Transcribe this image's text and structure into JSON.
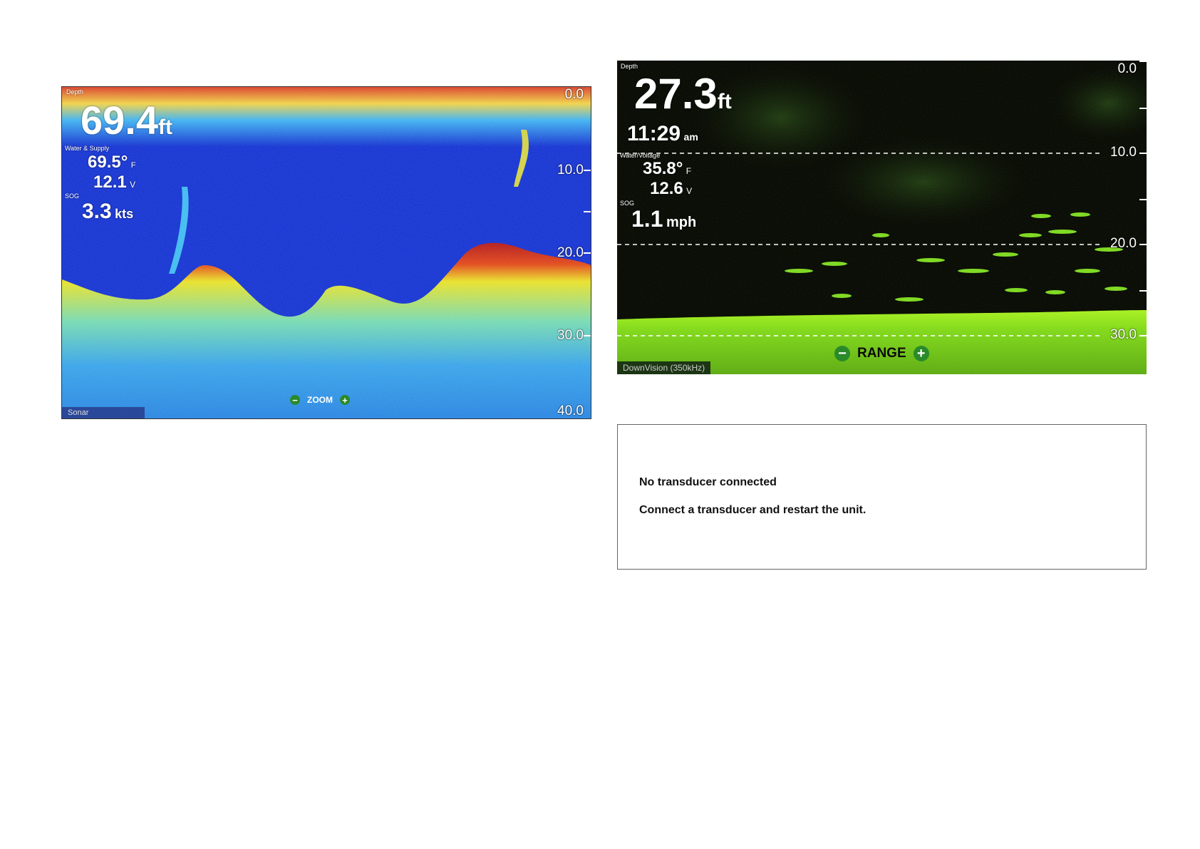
{
  "sonar": {
    "depth_label": "Depth",
    "depth_value": "69.4",
    "depth_unit": "ft",
    "group_label": "Water & Supply",
    "temp_value": "69.5°",
    "temp_unit": "F",
    "volt_value": "12.1",
    "volt_unit": "V",
    "sog_label": "SOG",
    "sog_value": "3.3",
    "sog_unit": "kts",
    "scale": [
      "0.0",
      "10.0",
      "20.0",
      "30.0",
      "40.0"
    ],
    "zoom_label": "ZOOM",
    "minus_glyph": "−",
    "plus_glyph": "+",
    "source_label": "Sonar"
  },
  "downvision": {
    "depth_label": "Depth",
    "depth_value": "27.3",
    "depth_unit": "ft",
    "time_value": "11:29",
    "time_suffix": "am",
    "group_label": "Water/Voltage",
    "temp_value": "35.8°",
    "temp_unit": "F",
    "volt_value": "12.6",
    "volt_unit": "V",
    "sog_label": "SOG",
    "sog_value": "1.1",
    "sog_unit": "mph",
    "scale": [
      "0.0",
      "10.0",
      "20.0",
      "30.0"
    ],
    "range_label": "RANGE",
    "minus_glyph": "−",
    "plus_glyph": "+",
    "source_label": "DownVision (350kHz)"
  },
  "message": {
    "title": "No transducer connected",
    "body": "Connect a transducer and restart the unit."
  },
  "colors": {
    "sonar_water": "#0a2ad0",
    "sonar_bottom_red": "#d01a10",
    "sonar_bottom_yellow": "#e6e020",
    "sonar_deep": "#3aa8e0",
    "dv_bottom": "#8ae010",
    "dv_targets": "#7cd820",
    "button_green": "#2a8a2a"
  }
}
